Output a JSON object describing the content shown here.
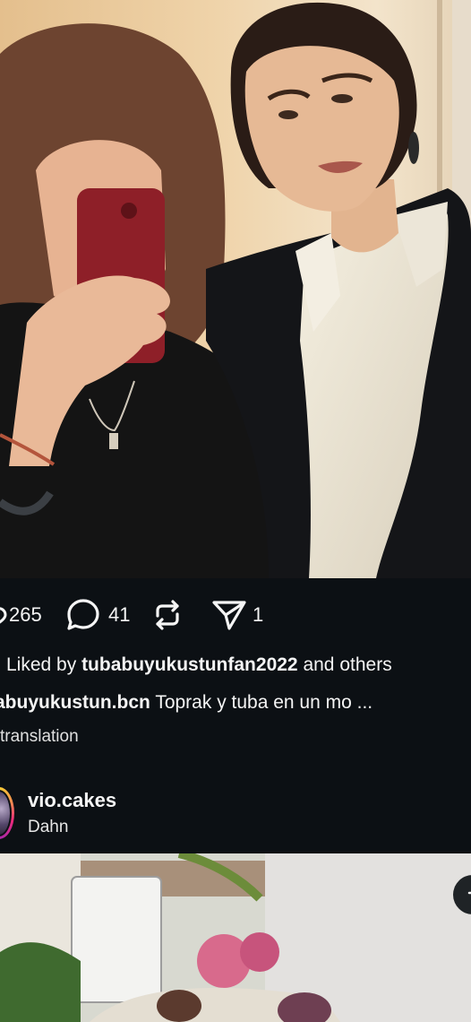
{
  "post": {
    "image_alt": "",
    "likes_count": "265",
    "comments_count": "41",
    "reposts_count": "",
    "shares_count": "1",
    "liked_by_prefix": "Liked by",
    "liked_by_user": "tubabuyukustunfan2022",
    "liked_by_suffix": "and others",
    "caption_author": "abuyukustun.bcn",
    "caption_text": "Toprak y tuba en un mo ...",
    "translation_link": "translation"
  },
  "next_post": {
    "author": "vio.cakes",
    "subtitle": "Dahn"
  },
  "icons": {
    "like": "heart-icon",
    "comment": "comment-bubble-icon",
    "repost": "repost-arrows-icon",
    "share": "send-paper-plane-icon",
    "more": "more-icon"
  },
  "colors": {
    "background": "#0c1014",
    "text": "#f5f5f5",
    "avatar_ring": "#ee2a7b"
  }
}
